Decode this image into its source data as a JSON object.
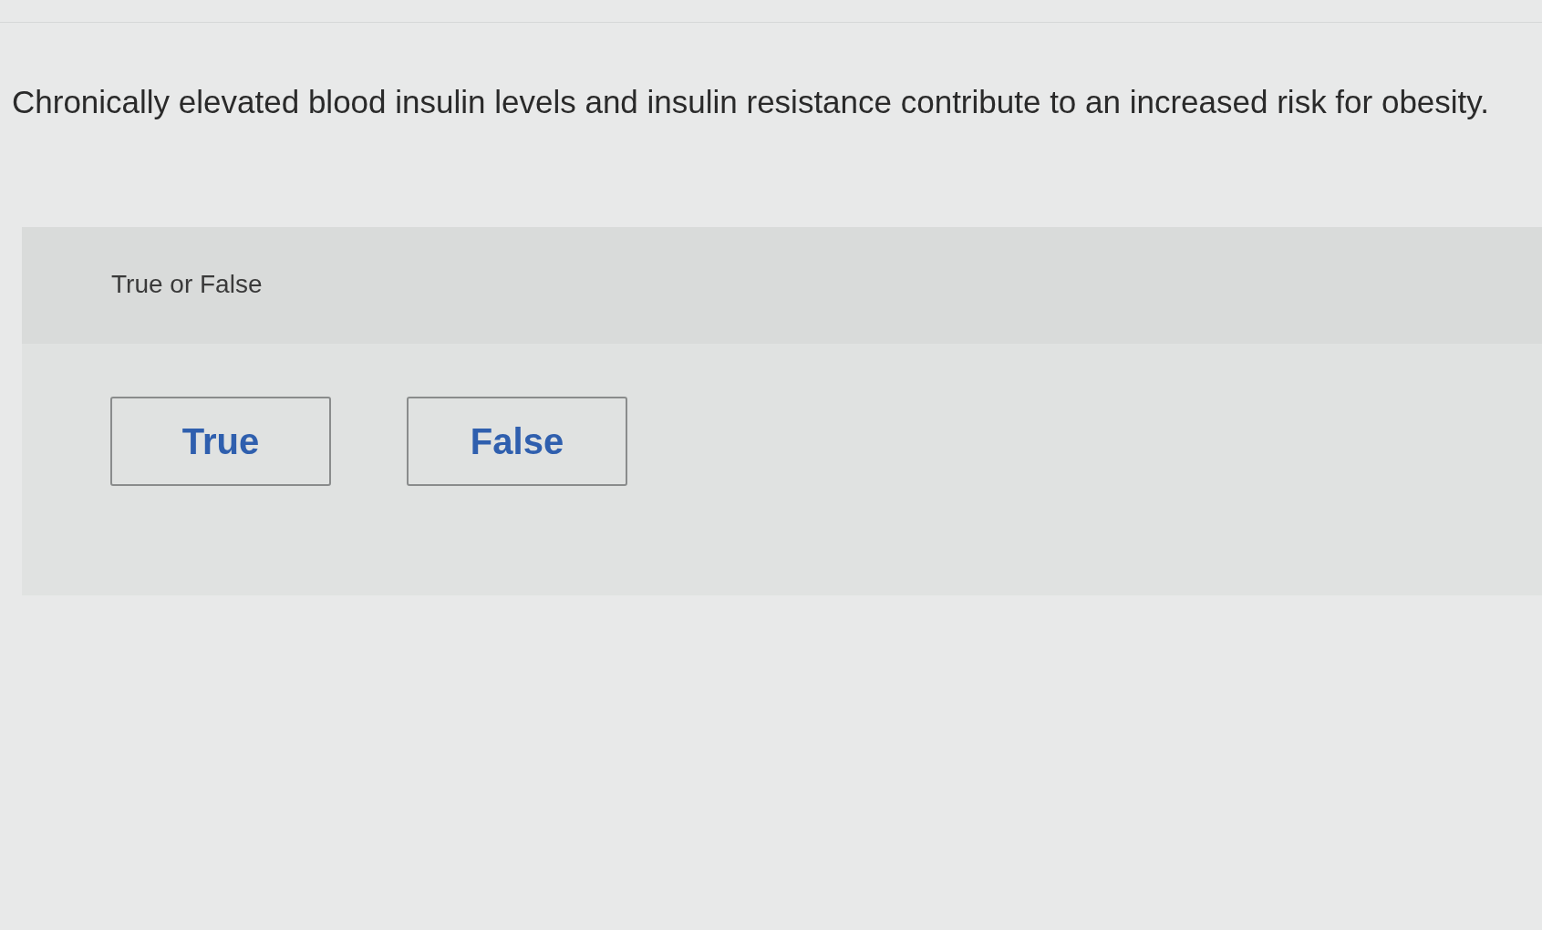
{
  "question": {
    "text": "Chronically elevated blood insulin levels and insulin resistance contribute to an increased risk for obesity."
  },
  "answer_panel": {
    "prompt": "True or False",
    "options": [
      {
        "label": "True",
        "selected": false
      },
      {
        "label": "False",
        "selected": false
      }
    ]
  }
}
